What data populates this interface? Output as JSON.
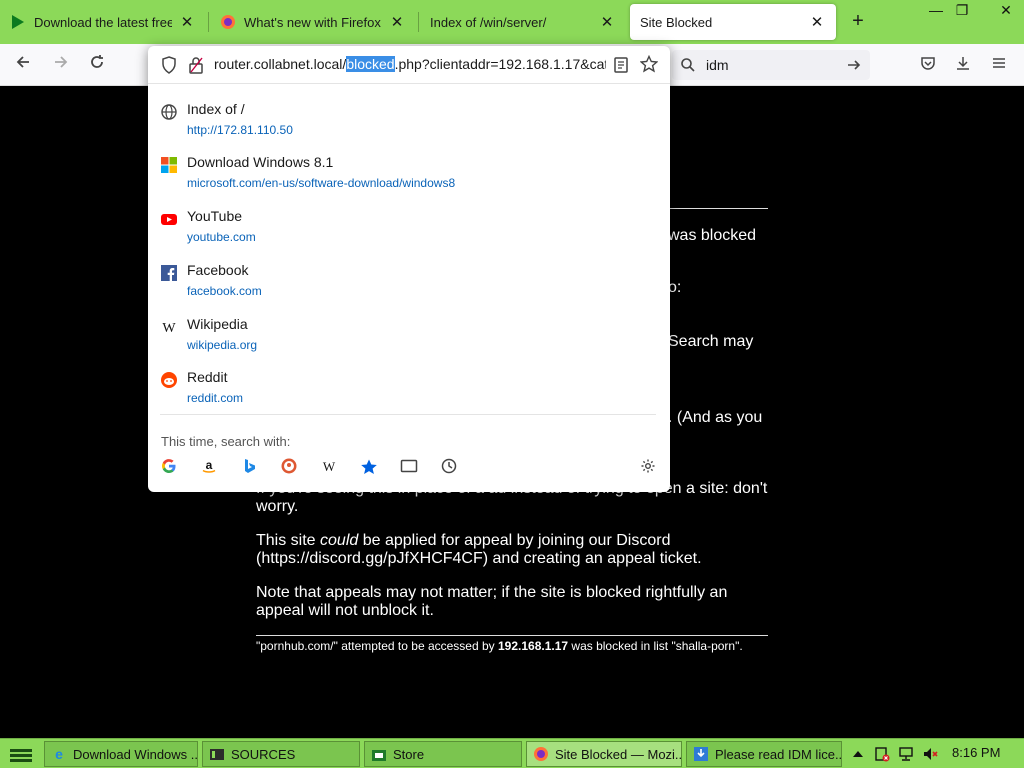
{
  "tabs": [
    {
      "title": "Download the latest free trial",
      "icon": "download-arrow-icon"
    },
    {
      "title": "What's new with Firefox - Mo",
      "icon": "firefox-icon"
    },
    {
      "title": "Index of /win/server/",
      "icon": "none"
    },
    {
      "title": "Site Blocked",
      "icon": "none",
      "active": true
    }
  ],
  "window_controls": {
    "minimize": "—",
    "restore": "❐",
    "close": "✕"
  },
  "navbar": {
    "url_before": "router.collabnet.local/",
    "url_selected": "blocked",
    "url_after": ".php?clientaddr=192.168.1.17&cat",
    "search_text": "idm"
  },
  "suggestions": [
    {
      "title": "Index of /",
      "url": "http://172.81.110.50",
      "icon": "globe-icon"
    },
    {
      "title": "Download Windows 8.1",
      "url": "microsoft.com/en-us/software-download/windows8",
      "icon": "microsoft-icon"
    },
    {
      "title": "YouTube",
      "url": "youtube.com",
      "icon": "youtube-icon"
    },
    {
      "title": "Facebook",
      "url": "facebook.com",
      "icon": "facebook-icon"
    },
    {
      "title": "Wikipedia",
      "url": "wikipedia.org",
      "icon": "wikipedia-icon"
    },
    {
      "title": "Reddit",
      "url": "reddit.com",
      "icon": "reddit-icon"
    }
  ],
  "search_with_label": "This time, search with:",
  "engines": [
    "google-icon",
    "amazon-icon",
    "bing-icon",
    "duckduckgo-icon",
    "wikipedia-icon",
    "bookmarks-icon",
    "tabs-icon",
    "history-icon",
    "settings-icon"
  ],
  "page": {
    "frag1": "was blocked",
    "frag2": "o:",
    "frag3": "Search may",
    "frag4": ". (And as you",
    "para_ad": "If you're seeing this in place of a ad instead of trying to open a site: don't worry.",
    "appeal_pre": "This site ",
    "appeal_em": "could",
    "appeal_post": " be applied for appeal by joining our Discord (https://discord.gg/pJfXHCF4CF) and creating an appeal ticket.",
    "note": "Note that appeals may not matter; if the site is blocked rightfully an appeal will not unblock it.",
    "footer_pre": "\"pornhub.com/\" attempted to be accessed by ",
    "footer_ip": "192.168.1.17",
    "footer_post": " was blocked in list \"shalla-porn\"."
  },
  "taskbar": {
    "items": [
      {
        "label": "Download Windows ...",
        "icon": "ie-icon"
      },
      {
        "label": "SOURCES",
        "icon": "folder-icon"
      },
      {
        "label": "Store",
        "icon": "store-icon"
      },
      {
        "label": "Site Blocked — Mozi...",
        "icon": "firefox-icon",
        "active": true
      },
      {
        "label": "Please read IDM lice...",
        "icon": "idm-icon"
      }
    ],
    "clock": "8:16 PM"
  },
  "colors": {
    "theme_green": "#8cd959",
    "link_blue": "#0a63b8",
    "selection": "#3a8ee6"
  }
}
